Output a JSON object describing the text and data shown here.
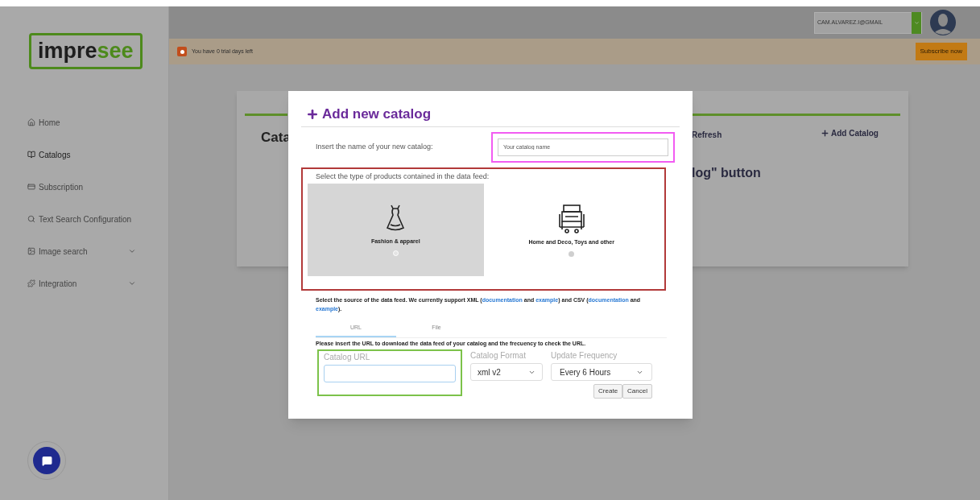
{
  "logo": {
    "text_dark": "impre",
    "text_green": "see"
  },
  "top_bar": {
    "account": "CAM.ALVAREZ.I@GMAIL"
  },
  "trial_banner": {
    "message": "You have 0 trial days left",
    "button": "Subscribe now"
  },
  "sidebar": {
    "items": [
      {
        "label": "Home",
        "selected": false,
        "expandable": false
      },
      {
        "label": "Catalogs",
        "selected": true,
        "expandable": false
      },
      {
        "label": "Subscription",
        "selected": false,
        "expandable": false
      },
      {
        "label": "Text Search Configuration",
        "selected": false,
        "expandable": false
      },
      {
        "label": "Image search",
        "selected": false,
        "expandable": true
      },
      {
        "label": "Integration",
        "selected": false,
        "expandable": true
      }
    ]
  },
  "catalog_card": {
    "title": "Cata",
    "refresh": "Refresh",
    "add": "Add Catalog",
    "empty_message": "log\" button"
  },
  "modal": {
    "title": "Add new catalog",
    "name_label": "Insert the name of your new catalog:",
    "name_placeholder": "Your catalog name",
    "type_label": "Select the type of products contained in the data feed:",
    "product_types": [
      {
        "kind": "dress",
        "label": "Fashion & apparel",
        "selected": true
      },
      {
        "kind": "home",
        "label": "Home and Deco, Toys and other",
        "selected": false
      }
    ],
    "source_text": [
      {
        "kind": "text",
        "text": "Select the source of the data feed. We currently support XML ("
      },
      {
        "kind": "link",
        "text": "documentation"
      },
      {
        "kind": "text",
        "text": " and "
      },
      {
        "kind": "link",
        "text": "example"
      },
      {
        "kind": "text",
        "text": ") and CSV ("
      },
      {
        "kind": "link",
        "text": "documentation"
      },
      {
        "kind": "text",
        "text": " and "
      },
      {
        "kind": "link",
        "text": "example"
      },
      {
        "kind": "text",
        "text": ")."
      }
    ],
    "tabs": [
      {
        "label": "URL",
        "selected": true
      },
      {
        "label": "File",
        "selected": false
      }
    ],
    "instruction": "Please insert the URL to download the data feed of your catalog and the frecuency to check the URL.",
    "url_label": "Catalog URL",
    "format_label": "Catalog Format",
    "format_value": "xml v2",
    "frequency_label": "Update Frequency",
    "frequency_value": "Every 6 Hours",
    "buttons": [
      "Create",
      "Cancel"
    ]
  }
}
